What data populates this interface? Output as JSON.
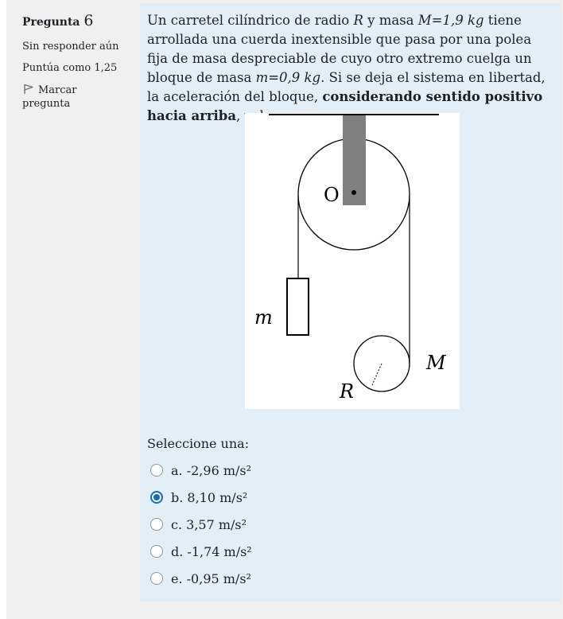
{
  "question": {
    "label": "Pregunta",
    "number": "6",
    "state": "Sin responder aún",
    "grade": "Puntúa como 1,25",
    "flag_label": "Marcar pregunta"
  },
  "qtext": {
    "t1": "Un carretel cilíndrico de radio ",
    "R": "R",
    "t2": " y masa ",
    "Mexpr": "M=1,9 kg",
    "t3": " tiene arrollada una cuerda inextensible que pasa por una polea fija de masa despreciable de cuyo otro extremo cuelga un bloque de masa ",
    "mexpr": "m=0,9 kg",
    "t4": ". Si se deja el sistema en libertad, la aceleración del bloque, ",
    "bold": "considerando sentido positivo hacia arriba",
    "t5": ", vale:"
  },
  "diagram": {
    "label_O": "O",
    "label_m": "m",
    "label_M": "M",
    "label_R": "R"
  },
  "prompt": "Seleccione una:",
  "options": [
    {
      "label": "a. -2,96 m/s²",
      "checked": false
    },
    {
      "label": "b. 8,10 m/s²",
      "checked": true
    },
    {
      "label": "c. 3,57 m/s²",
      "checked": false
    },
    {
      "label": "d. -1,74 m/s²",
      "checked": false
    },
    {
      "label": "e. -0,95 m/s²",
      "checked": false
    }
  ],
  "colors": {
    "accent": "#0f6cbf",
    "content_bg": "#e3eef7",
    "info_bg": "#f0f0f0"
  }
}
